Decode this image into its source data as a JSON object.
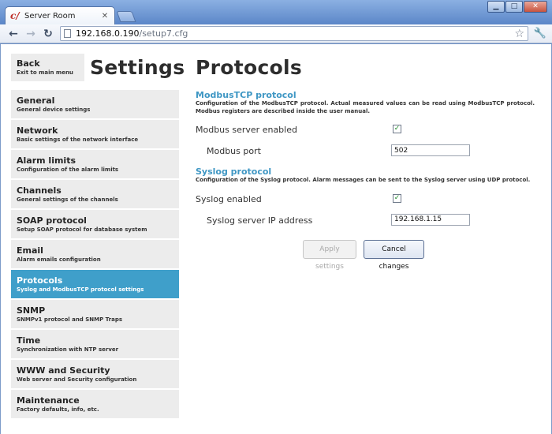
{
  "browser": {
    "tab_title": "Server Room",
    "tab_favicon": "c/",
    "url_host": "192.168.0.190",
    "url_path": "/setup7.cfg"
  },
  "header": {
    "back_label": "Back",
    "back_sub": "Exit to main menu",
    "settings_title": "Settings",
    "page_title": "Protocols"
  },
  "sidebar": {
    "items": [
      {
        "label": "General",
        "sub": "General device settings"
      },
      {
        "label": "Network",
        "sub": "Basic settings of the network interface"
      },
      {
        "label": "Alarm limits",
        "sub": "Configuration of the alarm limits"
      },
      {
        "label": "Channels",
        "sub": "General settings of the channels"
      },
      {
        "label": "SOAP protocol",
        "sub": "Setup SOAP protocol for database system"
      },
      {
        "label": "Email",
        "sub": "Alarm emails configuration"
      },
      {
        "label": "Protocols",
        "sub": "Syslog and ModbusTCP protocol settings"
      },
      {
        "label": "SNMP",
        "sub": "SNMPv1 protocol and SNMP Traps"
      },
      {
        "label": "Time",
        "sub": "Synchronization with NTP server"
      },
      {
        "label": "WWW and Security",
        "sub": "Web server and Security configuration"
      },
      {
        "label": "Maintenance",
        "sub": "Factory defaults, info, etc."
      }
    ],
    "active_index": 6
  },
  "modbus": {
    "title": "ModbusTCP protocol",
    "desc": "Configuration of the ModbusTCP protocol. Actual measured values can be read using ModbusTCP protocol. Modbus registers are described inside the user manual.",
    "enabled_label": "Modbus server enabled",
    "enabled": true,
    "port_label": "Modbus port",
    "port_value": "502"
  },
  "syslog": {
    "title": "Syslog protocol",
    "desc": "Configuration of the Syslog protocol. Alarm messages can be sent to the Syslog server using UDP protocol.",
    "enabled_label": "Syslog enabled",
    "enabled": true,
    "ip_label": "Syslog server IP address",
    "ip_value": "192.168.1.15"
  },
  "buttons": {
    "apply": "Apply settings",
    "cancel": "Cancel changes"
  },
  "icons": {
    "check": "✓"
  },
  "colors": {
    "accent": "#3f97c4",
    "active_item": "#3f9fca",
    "panel_bg": "#ececec"
  }
}
